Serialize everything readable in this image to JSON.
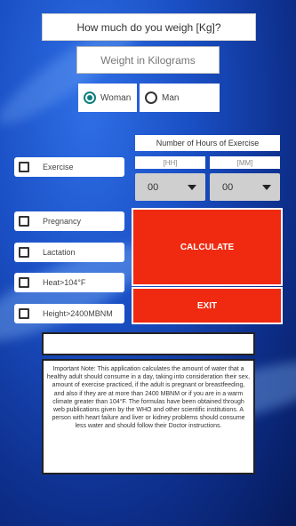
{
  "header": {
    "question": "How much do you weigh [Kg]?"
  },
  "weight_input": {
    "placeholder": "Weight in Kilograms"
  },
  "gender": {
    "woman_label": "Woman",
    "man_label": "Man",
    "selected": "Woman"
  },
  "exercise_hours": {
    "label": "Number of Hours of Exercise",
    "hh_placeholder": "[HH]",
    "mm_placeholder": "[MM]",
    "hh_value": "00",
    "mm_value": "00"
  },
  "checkboxes": {
    "exercise": "Exercise",
    "pregnancy": "Pregnancy",
    "lactation": "Lactation",
    "heat": "Heat>104°F",
    "height": "Height>2400MBNM"
  },
  "buttons": {
    "calculate": "CALCULATE",
    "exit": "EXIT"
  },
  "result": {
    "value": ""
  },
  "note": {
    "text": "Important Note: This application calculates the amount of water that a healthy adult should consume in a day, taking into consideration their sex, amount of exercise practiced, if the adult is pregnant or breastfeeding, and also if they are at more than 2400 MBNM or if you are in a warm climate greater than 104°F. The formulas have been obtained through web publications given by the WHO and other scientific institutions. A person with heart failure and liver or kidney problems should consume less water and should follow their Doctor instructions."
  },
  "colors": {
    "button": "#f02a10",
    "radio_accent": "#0f7f7f"
  }
}
